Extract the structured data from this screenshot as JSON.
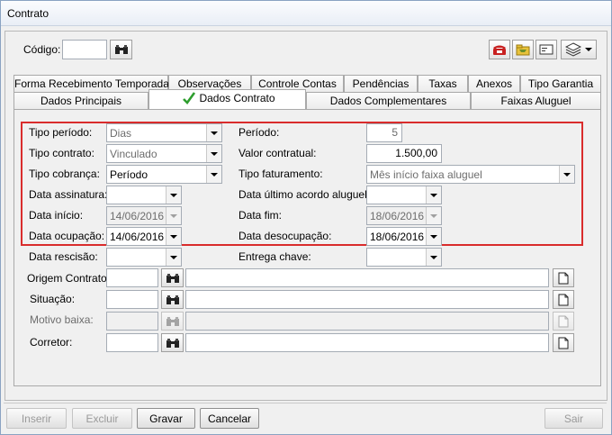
{
  "window": {
    "title": "Contrato"
  },
  "header": {
    "code_label": "Código:",
    "code_value": ""
  },
  "tabs_row1": [
    "Forma Recebimento Temporada",
    "Observações",
    "Controle Contas",
    "Pendências",
    "Taxas",
    "Anexos",
    "Tipo Garantia"
  ],
  "tabs_row2": [
    "Dados Principais",
    "Dados Contrato",
    "Dados Complementares",
    "Faixas Aluguel"
  ],
  "form": {
    "tipo_periodo": {
      "label": "Tipo período:",
      "value": "Dias"
    },
    "periodo": {
      "label": "Período:",
      "value": "5"
    },
    "tipo_contrato": {
      "label": "Tipo contrato:",
      "value": "Vinculado"
    },
    "valor_contratual": {
      "label": "Valor contratual:",
      "value": "1.500,00"
    },
    "tipo_cobranca": {
      "label": "Tipo cobrança:",
      "value": "Período"
    },
    "tipo_faturamento": {
      "label": "Tipo faturamento:",
      "value": "Mês início faixa aluguel"
    },
    "data_assinatura": {
      "label": "Data assinatura:",
      "value": ""
    },
    "data_ultimo_acordo": {
      "label": "Data último acordo aluguel:",
      "value": ""
    },
    "data_inicio": {
      "label": "Data início:",
      "value": "14/06/2016"
    },
    "data_fim": {
      "label": "Data fim:",
      "value": "18/06/2016"
    },
    "data_ocupacao": {
      "label": "Data ocupação:",
      "value": "14/06/2016"
    },
    "data_desocupacao": {
      "label": "Data desocupação:",
      "value": "18/06/2016"
    },
    "data_rescisao": {
      "label": "Data rescisão:",
      "value": ""
    },
    "entrega_chave": {
      "label": "Entrega chave:",
      "value": ""
    },
    "origem_contrato": {
      "label": "Origem Contrato:",
      "code": "",
      "desc": ""
    },
    "situacao": {
      "label": "Situação:",
      "code": "",
      "desc": ""
    },
    "motivo_baixa": {
      "label": "Motivo baixa:",
      "code": "",
      "desc": ""
    },
    "corretor": {
      "label": "Corretor:",
      "code": "",
      "desc": ""
    }
  },
  "buttons": {
    "inserir": "Inserir",
    "excluir": "Excluir",
    "gravar": "Gravar",
    "cancelar": "Cancelar",
    "sair": "Sair"
  },
  "colors": {
    "highlight": "#d92c2c",
    "check": "#2e9e2e"
  }
}
